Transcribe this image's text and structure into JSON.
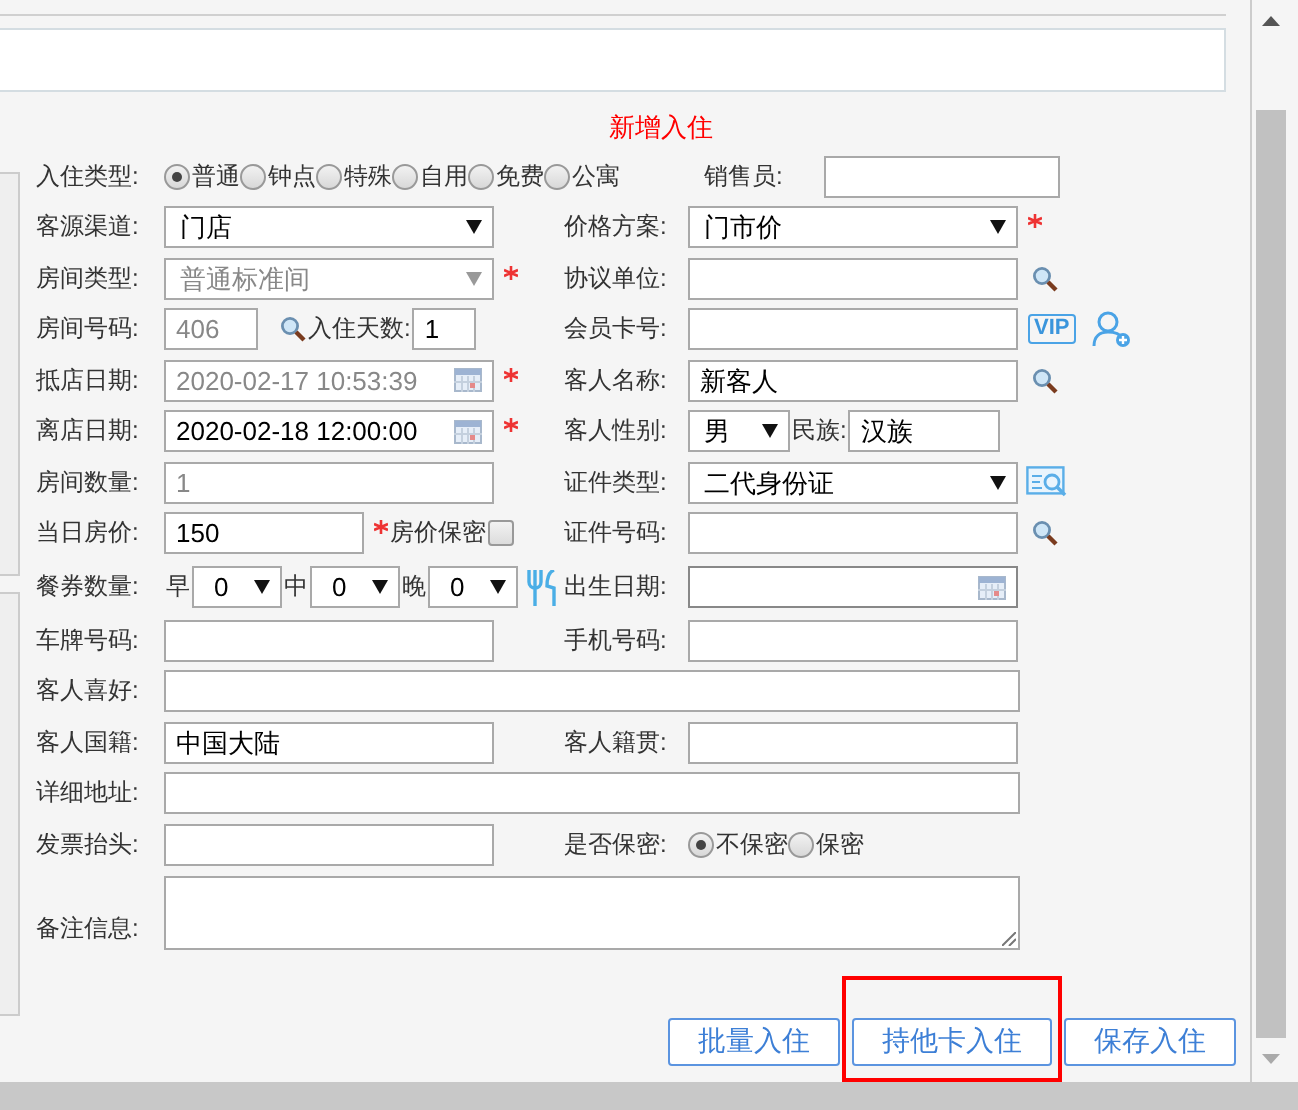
{
  "title": "新增入住",
  "checkin_type": {
    "label": "入住类型:",
    "options": [
      {
        "label": "普通",
        "selected": true
      },
      {
        "label": "钟点",
        "selected": false
      },
      {
        "label": "特殊",
        "selected": false
      },
      {
        "label": "自用",
        "selected": false
      },
      {
        "label": "免费",
        "selected": false
      },
      {
        "label": "公寓",
        "selected": false
      }
    ]
  },
  "salesperson": {
    "label": "销售员:"
  },
  "source_channel": {
    "label": "客源渠道:",
    "value": "门店"
  },
  "price_plan": {
    "label": "价格方案:",
    "value": "门市价",
    "required": true
  },
  "room_type": {
    "label": "房间类型:",
    "value": "普通标准间",
    "disabled": true,
    "required": true
  },
  "agreement_unit": {
    "label": "协议单位:"
  },
  "room_number": {
    "label": "房间号码:",
    "value": "406",
    "disabled": true
  },
  "stay_days": {
    "label": "入住天数:",
    "value": "1"
  },
  "member_card": {
    "label": "会员卡号:",
    "badge": "VIP"
  },
  "arrival_date": {
    "label": "抵店日期:",
    "value": "2020-02-17 10:53:39",
    "disabled": true,
    "required": true
  },
  "guest_name": {
    "label": "客人名称:",
    "value": "新客人"
  },
  "departure_date": {
    "label": "离店日期:",
    "value": "2020-02-18 12:00:00",
    "disabled": false,
    "required": true
  },
  "gender": {
    "label": "客人性别:",
    "value": "男"
  },
  "ethnicity": {
    "label": "民族:",
    "value": "汉族"
  },
  "room_count": {
    "label": "房间数量:",
    "value": "1",
    "disabled": true
  },
  "id_type": {
    "label": "证件类型:",
    "value": "二代身份证"
  },
  "daily_rate": {
    "label": "当日房价:",
    "value": "150",
    "required": true
  },
  "rate_confidential": {
    "label": "房价保密",
    "checked": false
  },
  "id_number": {
    "label": "证件号码:"
  },
  "meal_vouchers": {
    "label": "餐券数量:",
    "meals": [
      {
        "label": "早",
        "value": "0"
      },
      {
        "label": "中",
        "value": "0"
      },
      {
        "label": "晚",
        "value": "0"
      }
    ]
  },
  "birth_date": {
    "label": "出生日期:"
  },
  "plate_number": {
    "label": "车牌号码:"
  },
  "mobile": {
    "label": "手机号码:"
  },
  "preferences": {
    "label": "客人喜好:"
  },
  "nationality": {
    "label": "客人国籍:",
    "value": "中国大陆"
  },
  "native_place": {
    "label": "客人籍贯:"
  },
  "address": {
    "label": "详细地址:"
  },
  "invoice_title": {
    "label": "发票抬头:"
  },
  "confidential": {
    "label": "是否保密:",
    "options": [
      {
        "label": "不保密",
        "selected": true
      },
      {
        "label": "保密",
        "selected": false
      }
    ]
  },
  "notes": {
    "label": "备注信息:"
  },
  "buttons": [
    {
      "label": "批量入住",
      "highlighted": false
    },
    {
      "label": "持他卡入住",
      "highlighted": true
    },
    {
      "label": "保存入住",
      "highlighted": false
    }
  ]
}
